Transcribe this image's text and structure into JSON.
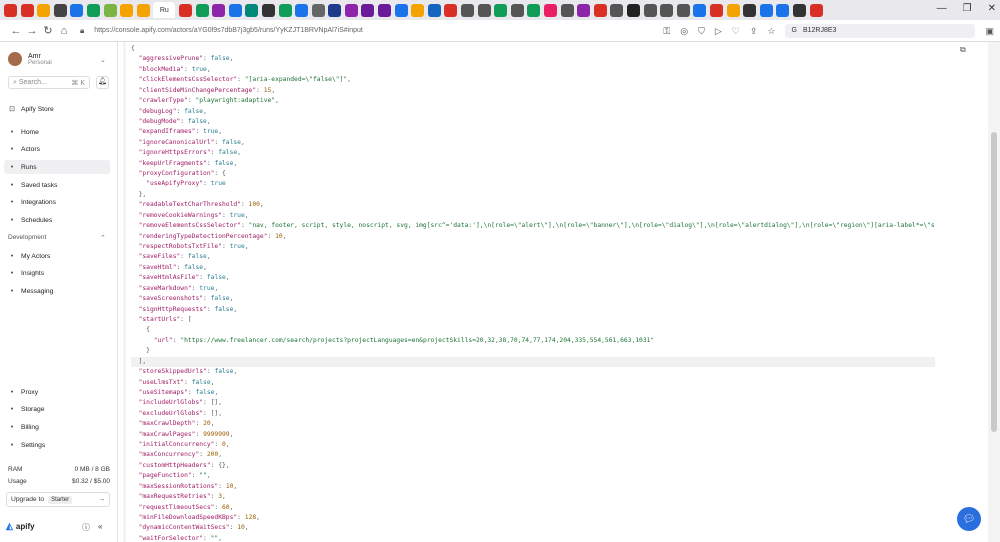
{
  "browser": {
    "active_tab_label": "Ru",
    "url": "https://console.apify.com/actors/aYG0l9s7dbB7j3gb5/runs/YyKZJT1BRVNpAl7iS#input",
    "search_value": "B12RJ8E3",
    "tab_colors": [
      "#d93025",
      "#d93025",
      "#f4a300",
      "#444",
      "#1a73e8",
      "#0f9d58",
      "#7cb342",
      "#f4a300",
      "#f4a300",
      "#ffffff",
      "#d93025",
      "#0f9d58",
      "#8e24aa",
      "#1a73e8",
      "#00897b",
      "#333",
      "#0f9d58",
      "#1a73e8",
      "#666",
      "#1e3a8a",
      "#8e24aa",
      "#6a1b9a",
      "#6a1b9a",
      "#1a73e8",
      "#f4a300",
      "#1565c0",
      "#d93025",
      "#555",
      "#555",
      "#0f9d58",
      "#555",
      "#0f9d58",
      "#e91e63",
      "#555",
      "#8e24aa",
      "#d93025",
      "#555",
      "#222",
      "#555",
      "#555",
      "#555",
      "#1a73e8",
      "#d93025",
      "#f4a300",
      "#333",
      "#1a73e8",
      "#1a73e8",
      "#333",
      "#d93025"
    ]
  },
  "sidebar": {
    "user_name": "Amr",
    "user_role": "Personal",
    "search_placeholder": "Search...",
    "search_shortcut": "⌘ K",
    "store_label": "Apify Store",
    "nav": [
      {
        "label": "Home",
        "icon": "home-icon"
      },
      {
        "label": "Actors",
        "icon": "actors-icon"
      },
      {
        "label": "Runs",
        "icon": "runs-icon"
      },
      {
        "label": "Saved tasks",
        "icon": "tasks-icon"
      },
      {
        "label": "Integrations",
        "icon": "integrations-icon"
      },
      {
        "label": "Schedules",
        "icon": "schedules-icon"
      }
    ],
    "dev_section": "Development",
    "dev_nav": [
      {
        "label": "My Actors",
        "icon": "my-actors-icon"
      },
      {
        "label": "Insights",
        "icon": "insights-icon"
      },
      {
        "label": "Messaging",
        "icon": "messaging-icon"
      }
    ],
    "bottom_nav": [
      {
        "label": "Proxy",
        "icon": "proxy-icon"
      },
      {
        "label": "Storage",
        "icon": "storage-icon"
      },
      {
        "label": "Billing",
        "icon": "billing-icon"
      },
      {
        "label": "Settings",
        "icon": "settings-icon"
      }
    ],
    "ram_label": "RAM",
    "ram_value": "0 MB / 8 GB",
    "usage_label": "Usage",
    "usage_value": "$0.32 / $5.00",
    "upgrade_label": "Upgrade to",
    "upgrade_plan": "Starter",
    "brand": "apify"
  },
  "json_lines": [
    [
      [
        "p",
        "{"
      ]
    ],
    [
      [
        "p",
        "  "
      ],
      [
        "k",
        "\"aggressivePrune\""
      ],
      [
        "p",
        ": "
      ],
      [
        "b",
        "false"
      ],
      [
        "p",
        ","
      ]
    ],
    [
      [
        "p",
        "  "
      ],
      [
        "k",
        "\"blockMedia\""
      ],
      [
        "p",
        ": "
      ],
      [
        "b",
        "true"
      ],
      [
        "p",
        ","
      ]
    ],
    [
      [
        "p",
        "  "
      ],
      [
        "k",
        "\"clickElementsCssSelector\""
      ],
      [
        "p",
        ": "
      ],
      [
        "s",
        "\"[aria-expanded=\\\"false\\\"]\""
      ],
      [
        "p",
        ","
      ]
    ],
    [
      [
        "p",
        "  "
      ],
      [
        "k",
        "\"clientSideMinChangePercentage\""
      ],
      [
        "p",
        ": "
      ],
      [
        "n",
        "15"
      ],
      [
        "p",
        ","
      ]
    ],
    [
      [
        "p",
        "  "
      ],
      [
        "k",
        "\"crawlerType\""
      ],
      [
        "p",
        ": "
      ],
      [
        "s",
        "\"playwright:adaptive\""
      ],
      [
        "p",
        ","
      ]
    ],
    [
      [
        "p",
        "  "
      ],
      [
        "k",
        "\"debugLog\""
      ],
      [
        "p",
        ": "
      ],
      [
        "b",
        "false"
      ],
      [
        "p",
        ","
      ]
    ],
    [
      [
        "p",
        "  "
      ],
      [
        "k",
        "\"debugMode\""
      ],
      [
        "p",
        ": "
      ],
      [
        "b",
        "false"
      ],
      [
        "p",
        ","
      ]
    ],
    [
      [
        "p",
        "  "
      ],
      [
        "k",
        "\"expandIframes\""
      ],
      [
        "p",
        ": "
      ],
      [
        "b",
        "true"
      ],
      [
        "p",
        ","
      ]
    ],
    [
      [
        "p",
        "  "
      ],
      [
        "k",
        "\"ignoreCanonicalUrl\""
      ],
      [
        "p",
        ": "
      ],
      [
        "b",
        "false"
      ],
      [
        "p",
        ","
      ]
    ],
    [
      [
        "p",
        "  "
      ],
      [
        "k",
        "\"ignoreHttpsErrors\""
      ],
      [
        "p",
        ": "
      ],
      [
        "b",
        "false"
      ],
      [
        "p",
        ","
      ]
    ],
    [
      [
        "p",
        "  "
      ],
      [
        "k",
        "\"keepUrlFragments\""
      ],
      [
        "p",
        ": "
      ],
      [
        "b",
        "false"
      ],
      [
        "p",
        ","
      ]
    ],
    [
      [
        "p",
        "  "
      ],
      [
        "k",
        "\"proxyConfiguration\""
      ],
      [
        "p",
        ": {"
      ]
    ],
    [
      [
        "p",
        "    "
      ],
      [
        "k",
        "\"useApifyProxy\""
      ],
      [
        "p",
        ": "
      ],
      [
        "b",
        "true"
      ]
    ],
    [
      [
        "p",
        "  },"
      ]
    ],
    [
      [
        "p",
        "  "
      ],
      [
        "k",
        "\"readableTextCharThreshold\""
      ],
      [
        "p",
        ": "
      ],
      [
        "n",
        "100"
      ],
      [
        "p",
        ","
      ]
    ],
    [
      [
        "p",
        "  "
      ],
      [
        "k",
        "\"removeCookieWarnings\""
      ],
      [
        "p",
        ": "
      ],
      [
        "b",
        "true"
      ],
      [
        "p",
        ","
      ]
    ],
    [
      [
        "p",
        "  "
      ],
      [
        "k",
        "\"removeElementsCssSelector\""
      ],
      [
        "p",
        ": "
      ],
      [
        "s",
        "\"nav, footer, script, style, noscript, svg, img[src^='data:'],\\n[role=\\\"alert\\\"],\\n[role=\\\"banner\\\"],\\n[role=\\\"dialog\\\"],\\n[role=\\\"alertdialog\\\"],\\n[role=\\\"region\\\"][aria-label*=\\\"s"
      ]
    ],
    [
      [
        "p",
        "  "
      ],
      [
        "k",
        "\"renderingTypeDetectionPercentage\""
      ],
      [
        "p",
        ": "
      ],
      [
        "n",
        "10"
      ],
      [
        "p",
        ","
      ]
    ],
    [
      [
        "p",
        "  "
      ],
      [
        "k",
        "\"respectRobotsTxtFile\""
      ],
      [
        "p",
        ": "
      ],
      [
        "b",
        "true"
      ],
      [
        "p",
        ","
      ]
    ],
    [
      [
        "p",
        "  "
      ],
      [
        "k",
        "\"saveFiles\""
      ],
      [
        "p",
        ": "
      ],
      [
        "b",
        "false"
      ],
      [
        "p",
        ","
      ]
    ],
    [
      [
        "p",
        "  "
      ],
      [
        "k",
        "\"saveHtml\""
      ],
      [
        "p",
        ": "
      ],
      [
        "b",
        "false"
      ],
      [
        "p",
        ","
      ]
    ],
    [
      [
        "p",
        "  "
      ],
      [
        "k",
        "\"saveHtmlAsFile\""
      ],
      [
        "p",
        ": "
      ],
      [
        "b",
        "false"
      ],
      [
        "p",
        ","
      ]
    ],
    [
      [
        "p",
        "  "
      ],
      [
        "k",
        "\"saveMarkdown\""
      ],
      [
        "p",
        ": "
      ],
      [
        "b",
        "true"
      ],
      [
        "p",
        ","
      ]
    ],
    [
      [
        "p",
        "  "
      ],
      [
        "k",
        "\"saveScreenshots\""
      ],
      [
        "p",
        ": "
      ],
      [
        "b",
        "false"
      ],
      [
        "p",
        ","
      ]
    ],
    [
      [
        "p",
        "  "
      ],
      [
        "k",
        "\"signHttpRequests\""
      ],
      [
        "p",
        ": "
      ],
      [
        "b",
        "false"
      ],
      [
        "p",
        ","
      ]
    ],
    [
      [
        "p",
        "  "
      ],
      [
        "k",
        "\"startUrls\""
      ],
      [
        "p",
        ": ["
      ]
    ],
    [
      [
        "p",
        "    {"
      ]
    ],
    [
      [
        "p",
        "      "
      ],
      [
        "k",
        "\"url\""
      ],
      [
        "p",
        ": "
      ],
      [
        "s",
        "\"https://www.freelancer.com/search/projects?projectLanguages=en&projectSkills=20,32,38,70,74,77,174,204,335,554,561,663,1031\""
      ]
    ],
    [
      [
        "p",
        "    }"
      ]
    ],
    [
      [
        "p",
        "  ],"
      ]
    ],
    [
      [
        "p",
        "  "
      ],
      [
        "k",
        "\"storeSkippedUrls\""
      ],
      [
        "p",
        ": "
      ],
      [
        "b",
        "false"
      ],
      [
        "p",
        ","
      ]
    ],
    [
      [
        "p",
        "  "
      ],
      [
        "k",
        "\"useLlmsTxt\""
      ],
      [
        "p",
        ": "
      ],
      [
        "b",
        "false"
      ],
      [
        "p",
        ","
      ]
    ],
    [
      [
        "p",
        "  "
      ],
      [
        "k",
        "\"useSitemaps\""
      ],
      [
        "p",
        ": "
      ],
      [
        "b",
        "false"
      ],
      [
        "p",
        ","
      ]
    ],
    [
      [
        "p",
        "  "
      ],
      [
        "k",
        "\"includeUrlGlobs\""
      ],
      [
        "p",
        ": [],"
      ]
    ],
    [
      [
        "p",
        "  "
      ],
      [
        "k",
        "\"excludeUrlGlobs\""
      ],
      [
        "p",
        ": [],"
      ]
    ],
    [
      [
        "p",
        "  "
      ],
      [
        "k",
        "\"maxCrawlDepth\""
      ],
      [
        "p",
        ": "
      ],
      [
        "n",
        "20"
      ],
      [
        "p",
        ","
      ]
    ],
    [
      [
        "p",
        "  "
      ],
      [
        "k",
        "\"maxCrawlPages\""
      ],
      [
        "p",
        ": "
      ],
      [
        "n",
        "9999999"
      ],
      [
        "p",
        ","
      ]
    ],
    [
      [
        "p",
        "  "
      ],
      [
        "k",
        "\"initialConcurrency\""
      ],
      [
        "p",
        ": "
      ],
      [
        "n",
        "0"
      ],
      [
        "p",
        ","
      ]
    ],
    [
      [
        "p",
        "  "
      ],
      [
        "k",
        "\"maxConcurrency\""
      ],
      [
        "p",
        ": "
      ],
      [
        "n",
        "200"
      ],
      [
        "p",
        ","
      ]
    ],
    [
      [
        "p",
        "  "
      ],
      [
        "k",
        "\"customHttpHeaders\""
      ],
      [
        "p",
        ": {},"
      ]
    ],
    [
      [
        "p",
        "  "
      ],
      [
        "k",
        "\"pageFunction\""
      ],
      [
        "p",
        ": "
      ],
      [
        "s",
        "\"\""
      ],
      [
        "p",
        ","
      ]
    ],
    [
      [
        "p",
        "  "
      ],
      [
        "k",
        "\"maxSessionRotations\""
      ],
      [
        "p",
        ": "
      ],
      [
        "n",
        "10"
      ],
      [
        "p",
        ","
      ]
    ],
    [
      [
        "p",
        "  "
      ],
      [
        "k",
        "\"maxRequestRetries\""
      ],
      [
        "p",
        ": "
      ],
      [
        "n",
        "3"
      ],
      [
        "p",
        ","
      ]
    ],
    [
      [
        "p",
        "  "
      ],
      [
        "k",
        "\"requestTimeoutSecs\""
      ],
      [
        "p",
        ": "
      ],
      [
        "n",
        "60"
      ],
      [
        "p",
        ","
      ]
    ],
    [
      [
        "p",
        "  "
      ],
      [
        "k",
        "\"minFileDownloadSpeedKBps\""
      ],
      [
        "p",
        ": "
      ],
      [
        "n",
        "128"
      ],
      [
        "p",
        ","
      ]
    ],
    [
      [
        "p",
        "  "
      ],
      [
        "k",
        "\"dynamicContentWaitSecs\""
      ],
      [
        "p",
        ": "
      ],
      [
        "n",
        "10"
      ],
      [
        "p",
        ","
      ]
    ],
    [
      [
        "p",
        "  "
      ],
      [
        "k",
        "\"waitForSelector\""
      ],
      [
        "p",
        ": "
      ],
      [
        "s",
        "\"\""
      ],
      [
        "p",
        ","
      ]
    ]
  ],
  "highlight_line": 30
}
